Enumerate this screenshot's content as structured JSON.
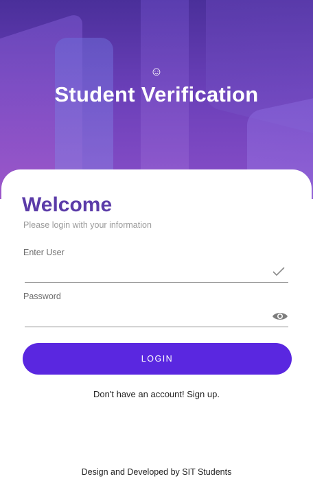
{
  "header": {
    "icon": "smile-icon",
    "title": "Student Verification"
  },
  "login_form": {
    "welcome": "Welcome",
    "subtitle": "Please login with your information",
    "user_label": "Enter User",
    "user_value": "",
    "password_label": "Password",
    "password_value": "",
    "user_status_icon": "checkmark-icon",
    "password_toggle_icon": "eye-icon",
    "login_button": "LOGIN",
    "signup_link": "Don't have an account! Sign up."
  },
  "footer": {
    "text": "Design and Developed by SIT Students"
  },
  "colors": {
    "primary": "#5a27e0",
    "welcome_text": "#5b3ba8",
    "header_gradient_top": "#4a2f9a",
    "header_gradient_bottom": "#8a4fc9"
  }
}
